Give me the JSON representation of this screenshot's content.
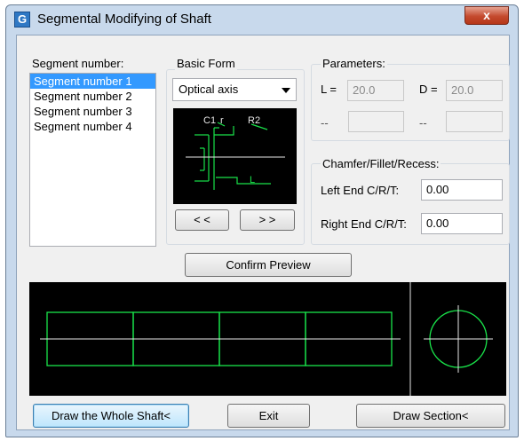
{
  "window": {
    "title": "Segmental Modifying of Shaft",
    "close_label": "x"
  },
  "segments": {
    "label": "Segment number:",
    "items": [
      "Segment number 1",
      "Segment number 2",
      "Segment number 3",
      "Segment number 4"
    ],
    "selected_index": 0
  },
  "basic_form": {
    "label": "Basic Form",
    "selected": "Optical axis",
    "preview_labels": {
      "c1": "C1",
      "r": "r",
      "r2": "R2",
      "l": "L"
    },
    "prev_button": "< <",
    "next_button": "> >"
  },
  "parameters": {
    "label": "Parameters:",
    "l_label": "L =",
    "l_value": "20.0",
    "d_label": "D =",
    "d_value": "20.0",
    "extra1_label": "--",
    "extra1_value": "",
    "extra2_label": "--",
    "extra2_value": ""
  },
  "chamfer": {
    "label": "Chamfer/Fillet/Recess:",
    "left_label": "Left End C/R/T:",
    "left_value": "0.00",
    "right_label": "Right End C/R/T:",
    "right_value": "0.00"
  },
  "buttons": {
    "confirm_preview": "Confirm  Preview",
    "draw_whole": "Draw the Whole Shaft<",
    "exit": "Exit",
    "draw_section": "Draw Section<"
  },
  "colors": {
    "drawing_line": "#19e34a",
    "axis_line": "#e8e8e8",
    "canvas_bg": "#000000",
    "selection": "#3399ff"
  }
}
